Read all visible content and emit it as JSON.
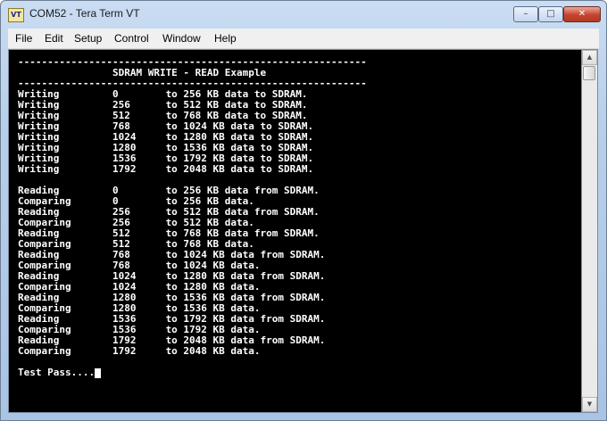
{
  "window": {
    "title": "COM52 - Tera Term VT",
    "icon_label": "VT",
    "controls": {
      "minimize": "–",
      "maximize": "□",
      "close": "✕"
    }
  },
  "menu": {
    "file": "File",
    "edit": "Edit",
    "setup": "Setup",
    "control": "Control",
    "window": "Window",
    "help": "Help"
  },
  "terminal": {
    "lines": [
      "-----------------------------------------------------------",
      "                SDRAM WRITE - READ Example",
      "-----------------------------------------------------------",
      "Writing         0        to 256 KB data to SDRAM.",
      "Writing         256      to 512 KB data to SDRAM.",
      "Writing         512      to 768 KB data to SDRAM.",
      "Writing         768      to 1024 KB data to SDRAM.",
      "Writing         1024     to 1280 KB data to SDRAM.",
      "Writing         1280     to 1536 KB data to SDRAM.",
      "Writing         1536     to 1792 KB data to SDRAM.",
      "Writing         1792     to 2048 KB data to SDRAM.",
      "",
      "Reading         0        to 256 KB data from SDRAM.",
      "Comparing       0        to 256 KB data.",
      "Reading         256      to 512 KB data from SDRAM.",
      "Comparing       256      to 512 KB data.",
      "Reading         512      to 768 KB data from SDRAM.",
      "Comparing       512      to 768 KB data.",
      "Reading         768      to 1024 KB data from SDRAM.",
      "Comparing       768      to 1024 KB data.",
      "Reading         1024     to 1280 KB data from SDRAM.",
      "Comparing       1024     to 1280 KB data.",
      "Reading         1280     to 1536 KB data from SDRAM.",
      "Comparing       1280     to 1536 KB data.",
      "Reading         1536     to 1792 KB data from SDRAM.",
      "Comparing       1536     to 1792 KB data.",
      "Reading         1792     to 2048 KB data from SDRAM.",
      "Comparing       1792     to 2048 KB data.",
      "",
      "Test Pass...."
    ],
    "cursor": "block"
  },
  "scrollbar": {
    "up_arrow": "▲",
    "down_arrow": "▼"
  },
  "colors": {
    "terminal_bg": "#000000",
    "terminal_fg": "#ffffff",
    "close_button": "#c7432e"
  }
}
